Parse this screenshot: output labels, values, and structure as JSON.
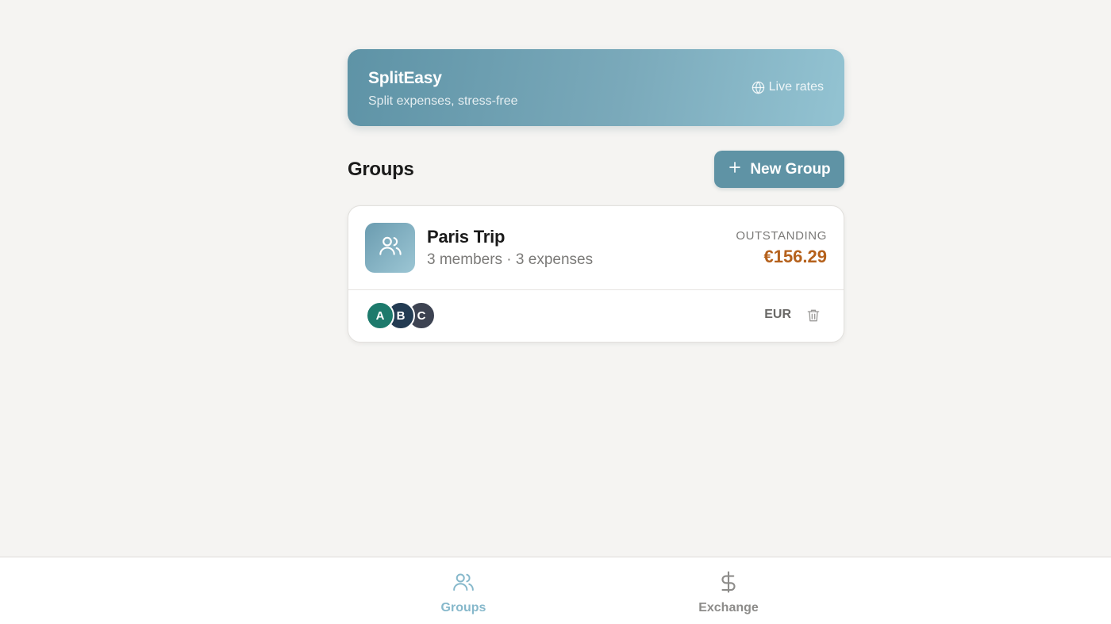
{
  "header": {
    "title": "SplitEasy",
    "subtitle": "Split expenses, stress-free",
    "live_rates": "Live rates"
  },
  "groups_section": {
    "title": "Groups",
    "new_group_label": "New Group"
  },
  "groups": [
    {
      "name": "Paris Trip",
      "meta": "3 members · 3 expenses",
      "outstanding_label": "OUTSTANDING",
      "outstanding_amount": "€156.29",
      "currency": "EUR",
      "members": [
        {
          "initial": "A",
          "color": "#1d7a6c"
        },
        {
          "initial": "B",
          "color": "#233b52"
        },
        {
          "initial": "C",
          "color": "#3d4352"
        }
      ]
    }
  ],
  "colors": {
    "accent": "#5f93a5",
    "outstanding": "#b5611c",
    "nav_active": "#86b8cb",
    "nav_inactive": "#8d8c8a"
  },
  "nav": {
    "groups_label": "Groups",
    "exchange_label": "Exchange"
  }
}
